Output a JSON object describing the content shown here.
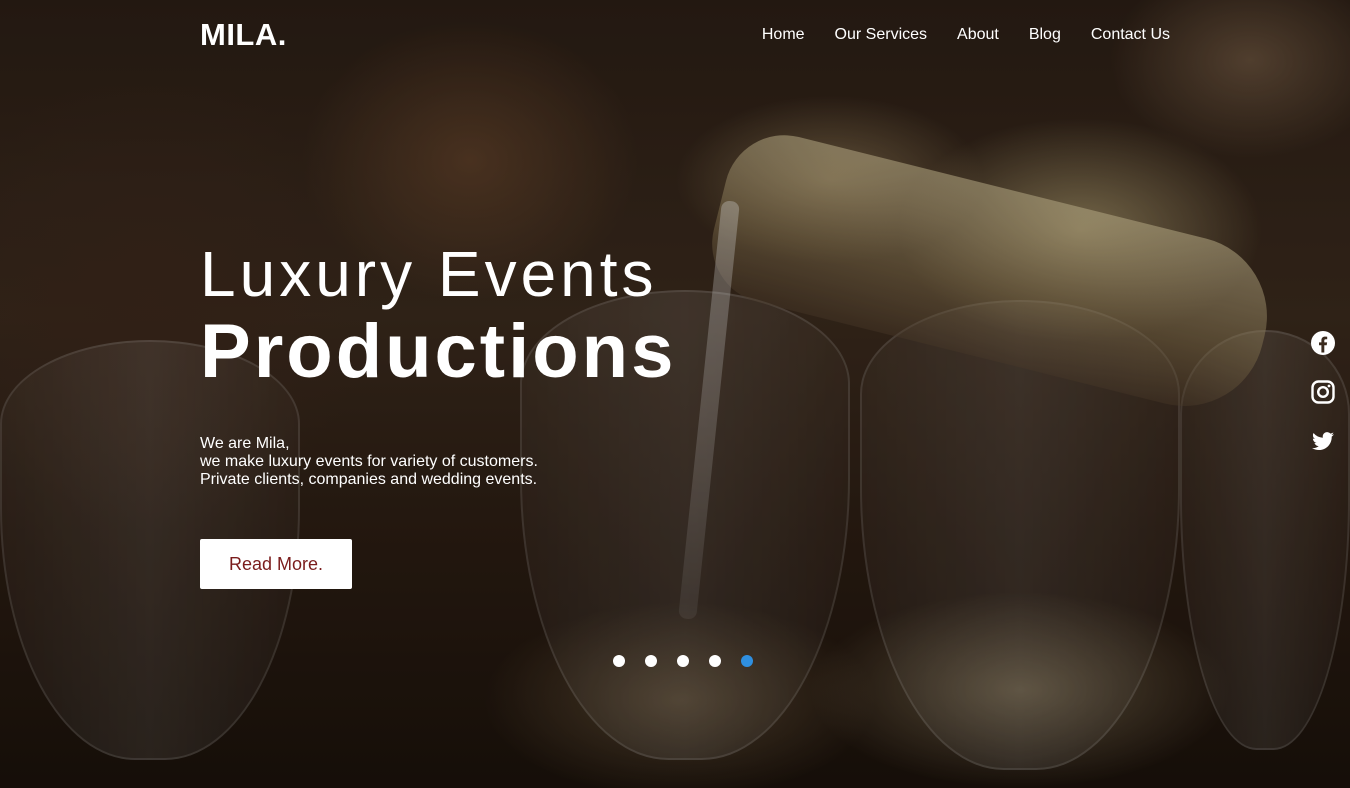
{
  "brand": {
    "logo": "MILA."
  },
  "nav": {
    "items": [
      {
        "label": "Home"
      },
      {
        "label": "Our Services"
      },
      {
        "label": "About"
      },
      {
        "label": "Blog"
      },
      {
        "label": "Contact Us"
      }
    ]
  },
  "hero": {
    "title_line1": "Luxury Events",
    "title_line2": "Productions",
    "description": [
      "We are Mila,",
      "we make luxury events for variety of customers.",
      "Private clients, companies and wedding events."
    ],
    "cta_label": "Read More."
  },
  "carousel": {
    "slide_count": 5,
    "active_index": 4,
    "active_color": "#2f8fe0"
  },
  "social": {
    "icons": [
      "facebook-icon",
      "instagram-icon",
      "twitter-icon"
    ]
  },
  "colors": {
    "cta_text": "#7a1c1c",
    "text": "#ffffff"
  }
}
